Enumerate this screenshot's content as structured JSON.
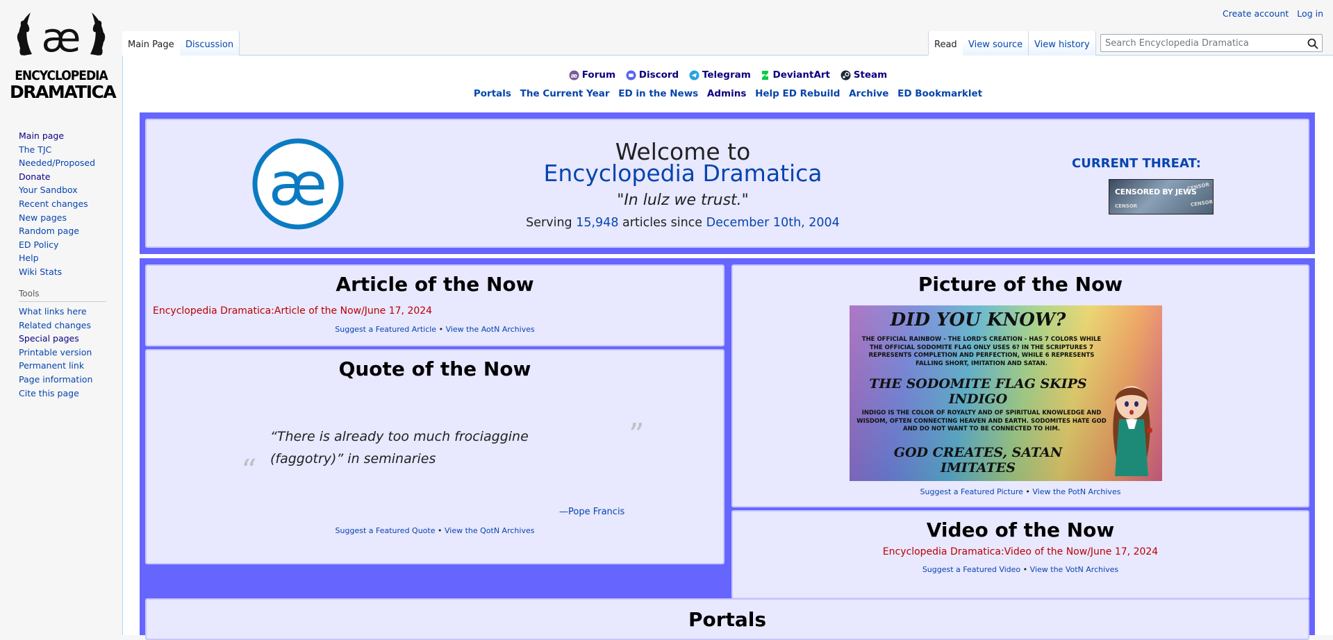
{
  "sidebar": {
    "logo_line1": "ENCYCLOPEDIA",
    "logo_line2": "DRAMATICA",
    "nav": [
      {
        "label": "Main page"
      },
      {
        "label": "The TJC"
      },
      {
        "label": "Needed/Proposed"
      },
      {
        "label": "Donate"
      },
      {
        "label": "Your Sandbox"
      },
      {
        "label": "Recent changes"
      },
      {
        "label": "New pages"
      },
      {
        "label": "Random page"
      },
      {
        "label": "ED Policy"
      },
      {
        "label": "Help"
      },
      {
        "label": "Wiki Stats"
      }
    ],
    "tools_heading": "Tools",
    "tools": [
      {
        "label": "What links here"
      },
      {
        "label": "Related changes"
      },
      {
        "label": "Special pages"
      },
      {
        "label": "Printable version"
      },
      {
        "label": "Permanent link"
      },
      {
        "label": "Page information"
      },
      {
        "label": "Cite this page"
      }
    ]
  },
  "header": {
    "create_account": "Create account",
    "log_in": "Log in",
    "tabs_left": [
      "Main Page",
      "Discussion"
    ],
    "tabs_right": [
      "Read",
      "View source",
      "View history"
    ],
    "search_placeholder": "Search Encyclopedia Dramatica"
  },
  "social": [
    "Forum",
    "Discord",
    "Telegram",
    "DeviantArt",
    "Steam"
  ],
  "links": [
    "Portals",
    "The Current Year",
    "ED in the News",
    "Admins",
    "Help ED Rebuild",
    "Archive",
    "ED Bookmarklet"
  ],
  "welcome": {
    "line1": "Welcome to",
    "line2": "Encyclopedia Dramatica",
    "motto": "\"In lulz we trust.\"",
    "serving_prefix": "Serving ",
    "article_count": "15,948",
    "serving_mid": " articles since ",
    "since_date": "December 10th, 2004",
    "threat_label": "CURRENT THREAT:",
    "threat_image_text": "CENSORED BY JEWS",
    "threat_stamp1": "CENSOR",
    "threat_stamp2": "CENSOR",
    "threat_stamp3": "CENSOR"
  },
  "aotn": {
    "title": "Article of the Now",
    "link": "Encyclopedia Dramatica:Article of the Now/June 17, 2024",
    "suggest": "Suggest a Featured Article",
    "archives": "View the AotN Archives"
  },
  "qotn": {
    "title": "Quote of the Now",
    "quote": "“There is already too much frociaggine (faggotry)” in seminaries",
    "open_mark": "“",
    "close_mark": "”",
    "attribution_dash": "—",
    "attribution": "Pope Francis",
    "suggest": "Suggest a Featured Quote",
    "archives": "View the QotN Archives"
  },
  "potn": {
    "title": "Picture of the Now",
    "img_heading": "DID YOU KNOW?",
    "img_text1": "THE OFFICIAL RAINBOW - THE LORD'S CREATION - HAS 7 COLORS WHILE THE OFFICIAL SODOMITE FLAG ONLY USES 6? IN THE SCRIPTURES 7 REPRESENTS COMPLETION AND PERFECTION, WHILE 6 REPRESENTS FALLING SHORT, IMITATION AND SATAN.",
    "img_heading2a": "THE SODOMITE FLAG SKIPS",
    "img_heading2b": "INDIGO",
    "img_text2": "INDIGO IS THE COLOR OF ROYALTY AND OF SPIRITUAL KNOWLEDGE AND WISDOM, OFTEN CONNECTING HEAVEN AND EARTH. SODOMITES HATE GOD AND DO NOT WANT TO BE CONNECTED TO HIM.",
    "img_footer_a": "GOD CREATES, SATAN",
    "img_footer_b": "IMITATES",
    "suggest": "Suggest a Featured Picture",
    "archives": "View the PotN Archives"
  },
  "votn": {
    "title": "Video of the Now",
    "link": "Encyclopedia Dramatica:Video of the Now/June 17, 2024",
    "suggest": "Suggest a Featured Video",
    "archives": "View the VotN Archives"
  },
  "portals": {
    "title": "Portals"
  },
  "separator": "•",
  "colors": {
    "frame": "#6666ff",
    "panel": "#e8e8ff",
    "link": "#0645ad",
    "redlink": "#ba0000"
  }
}
